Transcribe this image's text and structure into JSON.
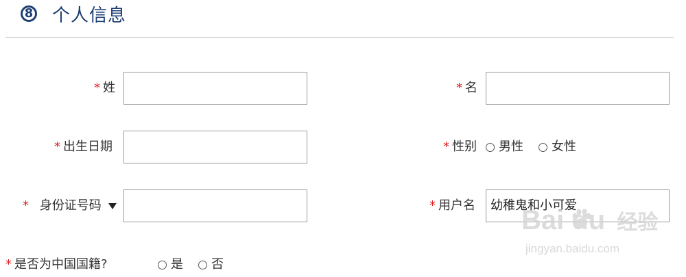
{
  "header": {
    "step_number": "8",
    "title": "个人信息"
  },
  "form": {
    "required_mark": "*",
    "last_name": {
      "label": "姓",
      "value": ""
    },
    "first_name": {
      "label": "名",
      "value": ""
    },
    "birth_date": {
      "label": "出生日期",
      "value": ""
    },
    "gender": {
      "label": "性别",
      "options": [
        "男性",
        "女性"
      ]
    },
    "id_type": {
      "label": "身份证号码",
      "value": ""
    },
    "username": {
      "label": "用户名",
      "value": "幼稚鬼和小可爱"
    },
    "chinese_citizen": {
      "label": "是否为中国国籍?",
      "options": [
        "是",
        "否"
      ]
    }
  },
  "watermark": {
    "brand": "Bai  du",
    "product": "经验",
    "url": "jingyan.baidu.com"
  },
  "colors": {
    "accent": "#1d3f72",
    "required": "#e02020"
  }
}
